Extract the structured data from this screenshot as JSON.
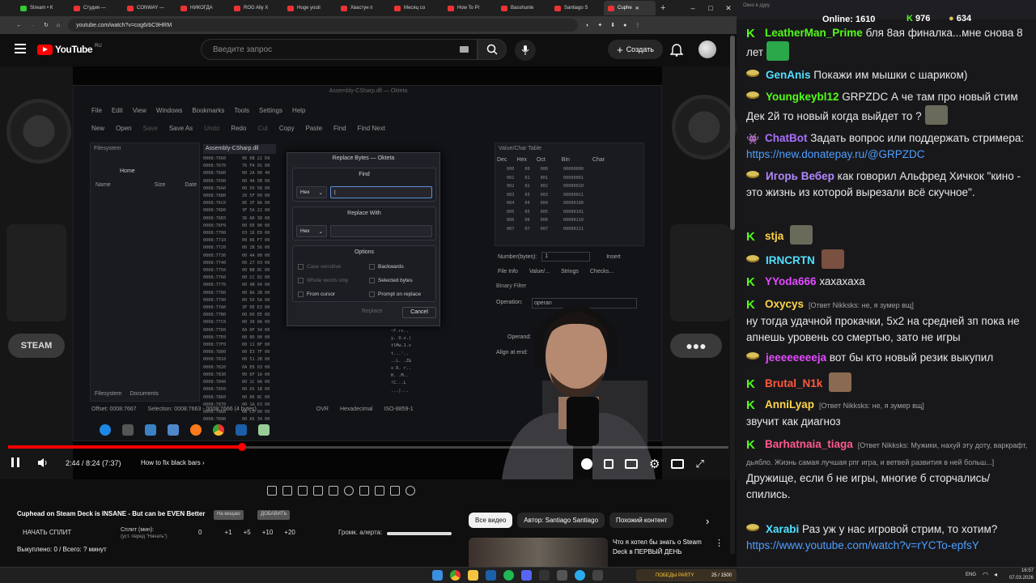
{
  "browser": {
    "tabs": [
      "Stream • K",
      "Студия —",
      "CONWAY —",
      "НИКОГДА",
      "ROG Ally X",
      "Huge youti",
      "Хвастун п",
      "Месяц со",
      "How To Pl",
      "Basshunte",
      "Santiago S",
      "Cuphe"
    ],
    "url": "youtube.com/watch?v=cog6rbC9HRM"
  },
  "youtube": {
    "logo_text": "YouTube",
    "region": "RU",
    "search_placeholder": "Введите запрос",
    "create_label": "Создать"
  },
  "video": {
    "okteta": {
      "title": "Assembly-CSharp.dll — Okteta",
      "menu": [
        "File",
        "Edit",
        "View",
        "Windows",
        "Bookmarks",
        "Tools",
        "Settings",
        "Help"
      ],
      "toolbar": [
        "New",
        "Open",
        "Save",
        "Save As",
        "Undo",
        "Redo",
        "Cut",
        "Copy",
        "Paste",
        "Find",
        "Find Next"
      ],
      "filesystem_title": "Filesystem",
      "home_label": "Home",
      "cols": [
        "Name",
        "Size",
        "Date"
      ],
      "doc_tab": "Assembly-CSharp.dll",
      "value_char_title": "Value/Char Table",
      "vc_cols": [
        "Dec",
        "Hex",
        "Oct",
        "Bin",
        "Char"
      ],
      "vc_rows": [
        [
          "000",
          "00",
          "000",
          "00000000"
        ],
        [
          "001",
          "01",
          "001",
          "00000001"
        ],
        [
          "002",
          "02",
          "002",
          "00000010"
        ],
        [
          "003",
          "03",
          "003",
          "00000011"
        ],
        [
          "004",
          "04",
          "004",
          "00000100"
        ],
        [
          "005",
          "05",
          "005",
          "00000101"
        ],
        [
          "006",
          "06",
          "006",
          "00000110"
        ],
        [
          "007",
          "07",
          "007",
          "00000111"
        ]
      ],
      "number_bytes_label": "Number(bytes):",
      "number_bytes_value": "1",
      "insert_label": "Insert",
      "info_tabs": [
        "File Info",
        "Value/...",
        "Strings",
        "Checks..."
      ],
      "binary_filter_title": "Binary Filter",
      "operation_label": "Operation:",
      "operation_value": "operan",
      "operand_label": "Operand:",
      "align_label": "Align at end:",
      "bottom_tabs": [
        "Filesystem",
        "Documents"
      ],
      "status_offset": "Offset: 0008:7667",
      "status_selection": "Selection: 0008:7663 - 0008:7666 (4 bytes)",
      "status_ovr": "OVR",
      "status_mode": "Hexadecimal",
      "status_charset": "ISO-8859-1",
      "hex_offsets": [
        "0008:7660",
        "0008:7670",
        "0008:7680",
        "0008:7690",
        "0008:76A0",
        "0008:76B0",
        "0008:76C0",
        "0008:76D0",
        "0008:76E0",
        "0008:76F0",
        "0008:7700",
        "0008:7710",
        "0008:7720",
        "0008:7730",
        "0008:7740",
        "0008:7750",
        "0008:7760",
        "0008:7770",
        "0008:7780",
        "0008:7790",
        "0008:77A0",
        "0008:77B0",
        "0008:77C0",
        "0008:77D0",
        "0008:77E0",
        "0008:77F0",
        "0008:7800",
        "0008:7810",
        "0008:7820",
        "0008:7830",
        "0008:7840",
        "0008:7850",
        "0008:7860",
        "0008:7870",
        "0008:7880",
        "0008:7890"
      ],
      "hex_bytes": [
        "06 6B 22 D9",
        "76 FA 01 00",
        "00 2A 00 40",
        "00 4A 5B 00",
        "00 50 58 00",
        "20 5F 09 00",
        "0E 3F 8A 00",
        "3F 5A 22 00",
        "36 A0 38 00",
        "00 6E 00 00",
        "03 16 E0 00",
        "00 06 F7 00",
        "00 2B 56 00",
        "00 4A 00 00",
        "00 27 03 00",
        "00 BB 0C 00",
        "00 CC 02 00",
        "00 4B 94 00",
        "00 8A 2B 00",
        "00 50 5A 00",
        "3F 0E E3 00",
        "00 D6 EE 00",
        "00 38 0A 00",
        "0A 0F 34 00",
        "00 0D 00 00",
        "00 11 8F 00",
        "00 E3 7F 00",
        "00 51 2B 00",
        "0A E6 03 00",
        "00 6F 1A 00",
        "00 1C 9A 00",
        "00 65 1B 00",
        "00 86 8C 00",
        "00 1A 63 00",
        "00 C0 00 00",
        "00 A5 34 00"
      ],
      "hex_ascii_rows": [
        "A D. (.-",
        "u  ^ . ^",
        "\\.l\\@@.~",
        "l0,/ E.",
        "#.7!lg ~",
        "~F.rv..",
        "y. U.x.(",
        "tlMw.1.v",
        "t...'..",
        "..L. .Z&",
        "x D. r..",
        "H. .M..",
        "!C...L",
        "...|..."
      ]
    },
    "dialog": {
      "title": "Replace Bytes — Okteta",
      "find_label": "Find",
      "replace_label": "Replace With",
      "find_mode": "Hex",
      "replace_mode": "Hex",
      "options_label": "Options",
      "case_sensitive": "Case sensitive",
      "whole_words": "Whole words only",
      "from_cursor": "From cursor",
      "backwards": "Backwards",
      "selected_bytes": "Selected bytes",
      "prompt_on_replace": "Prompt on replace",
      "replace_btn": "Replace",
      "cancel_btn": "Cancel"
    },
    "deck_buttons": {
      "steam": "STEAM",
      "menu": "●●●"
    },
    "time": "2:44 / 8:24 (7:37)",
    "chapter": "How to fix black bars",
    "progress": 0.325
  },
  "below": {
    "title": "Cuphead on Steam Deck is INSANE - But can be EVEN Better",
    "pill1": "На вещаю",
    "pill2": "ДОБАВИТЬ",
    "split_label": "НАЧАТЬ СПЛИТ",
    "split_min": "Сплит (мин):",
    "split_sub": "(уст. перед \"Начать\")",
    "split_vals": [
      "0",
      "+1",
      "+5",
      "+10",
      "+20"
    ],
    "alert_label": "Громк. алерта:",
    "sold": "Выкуплено: 0 / Всего: ? минут"
  },
  "recs": {
    "tabs": [
      "Все видео",
      "Автор: Santiago Santiago",
      "Похожий контент"
    ],
    "title": "Что я хотел бы знать о Steam Deck в ПЕРВЫЙ ДЕНЬ"
  },
  "chat": {
    "window_title": "Окно в дуру",
    "online_label": "Online:",
    "online": "1610",
    "k_count": "976",
    "coins": "634",
    "messages": [
      {
        "badge": "k",
        "nick": "LeatherMan_Prime",
        "color": "#53fc18",
        "reply": "",
        "text": "бля 8ая финалка...мне снова 8 лет"
      },
      {
        "badge": "g",
        "nick": "GenAnis",
        "color": "#4fe1ff",
        "reply": "",
        "text": "Покажи им мышки с шариком)"
      },
      {
        "badge": "g",
        "nick": "Youngkeybl12",
        "color": "#53fc18",
        "reply": "",
        "text": "GRPZDC А че там про новый стим Дек  2й то новый когда выйдет то ?"
      },
      {
        "badge": "bot",
        "nick": "ChatBot",
        "color": "#a970ff",
        "reply": "",
        "text": "Задать вопрос или поддержать стримера: ",
        "link": "https://new.donatepay.ru/@GRPZDC"
      },
      {
        "badge": "g",
        "nick": "Игорь Вебер",
        "color": "#b388ff",
        "reply": "",
        "text": "как говорил Альфред Хичкок \"кино - это жизнь из которой вырезали всё скучное\"."
      },
      {
        "badge": "k",
        "nick": "stja",
        "color": "#ffd54a",
        "reply": "",
        "text": ""
      },
      {
        "badge": "g",
        "nick": "IRNCRTN",
        "color": "#4fe1ff",
        "reply": "",
        "text": ""
      },
      {
        "badge": "k",
        "nick": "YYoda666",
        "color": "#e34bff",
        "reply": "",
        "text": "хахахаха"
      },
      {
        "badge": "k",
        "nick": "Oxycys",
        "color": "#ffd54a",
        "reply": "[Ответ Nikksks: не, я зумер вщ]",
        "text": "ну тогда удачной прокачки, 5х2 на средней зп пока не апнешь уровень со смертью, зато не игры"
      },
      {
        "badge": "g",
        "nick": "jeeeeeeeeja",
        "color": "#e34bff",
        "reply": "",
        "text": "вот бы кто новый резик выкупил"
      },
      {
        "badge": "k",
        "nick": "Brutal_N1k",
        "color": "#ff5a3c",
        "reply": "",
        "text": ""
      },
      {
        "badge": "k",
        "nick": "AnniLyap",
        "color": "#ffd54a",
        "reply": "[Ответ Nikksks: не, я зумер вщ]",
        "text": "звучит как диагноз"
      },
      {
        "badge": "k",
        "nick": "Barhatnaia_tiaga",
        "color": "#ff5a8c",
        "reply": "[Ответ Nikksks: Мужики, нахуй эту доту, варкрафт, дьябло. Жизнь самая лучшая рпг игра, и ветвей развития в ней больш...]",
        "text": "Дружище, если б не игры, многие б сторчались/спились."
      },
      {
        "badge": "g",
        "nick": "Xarabi",
        "color": "#4fe1ff",
        "reply": "",
        "text": "Раз уж у нас игровой стрим, то хотим? ",
        "link": "https://www.youtube.com/watch?v=rYCTo-epfsY"
      }
    ]
  },
  "taskbar": {
    "lang": "ENG",
    "time": "16:57",
    "date": "07.03.2026",
    "kick_widget": "ПОБЕДЫ PARTY",
    "kick_widget_count": "25 / 1500"
  },
  "colors": {
    "accent": "#ff0000",
    "kick": "#53fc18",
    "link": "#4f9eff"
  }
}
